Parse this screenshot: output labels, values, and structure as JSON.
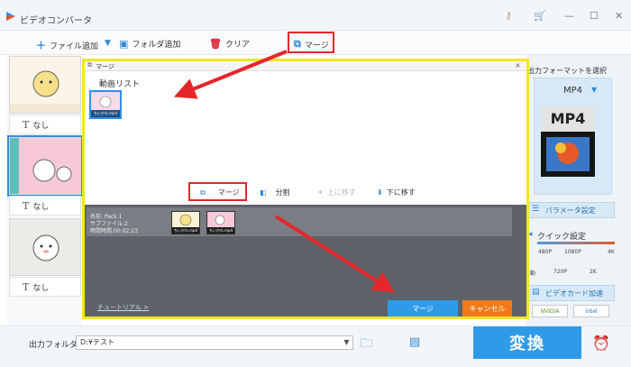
{
  "app": {
    "title": "ビデオコンバータ"
  },
  "window_controls": {
    "minimize": "—",
    "maximize": "☐",
    "close": "✕"
  },
  "toolbar": {
    "add_file": "ファイル追加",
    "add_folder": "フォルダ追加",
    "clear": "クリア",
    "merge": "マージ"
  },
  "file_list": {
    "items": [
      {
        "subtitle": "なし",
        "subtitle_icon": "T"
      },
      {
        "subtitle": "なし",
        "subtitle_icon": "T"
      },
      {
        "subtitle": "なし",
        "subtitle_icon": "T"
      }
    ]
  },
  "output_format": {
    "header": "出力フォーマットを選択",
    "name": "MP4",
    "icon_text": "MP4",
    "param_button": "パラメータ設定",
    "quick_label": "クイック設定",
    "quick_ticks_top": [
      "480P",
      "1080P",
      "4K"
    ],
    "quick_ticks_bottom": [
      "動",
      "720P",
      "2K"
    ],
    "gpu_button": "ビデオカード加速",
    "gpu_badges": [
      "NVIDIA",
      "intel"
    ]
  },
  "dialog": {
    "title": "マージ",
    "video_list_label": "動画リスト",
    "thumb_caption": "ちいかわ.mp4",
    "actions": {
      "merge": "マージ",
      "split": "分割",
      "move_up": "上に移す",
      "move_down": "下に移す"
    },
    "pack": {
      "name": "名前: Pack 1",
      "sub_files": "サブファイル:2",
      "duration": "時間時間:00:02:23",
      "thumb_captions": [
        "ちいかわ.mp4",
        "ちいかわ.mp4"
      ]
    },
    "tutorial_link": "チュートリアル >",
    "merge_button": "マージ",
    "cancel_button": "キャンセル"
  },
  "bottom": {
    "output_folder_label": "出力フォルダ：",
    "output_path": "D:¥テスト",
    "convert_button": "変換"
  },
  "colors": {
    "accent": "#2f9be8",
    "highlight": "#e6262a",
    "dialog_border": "#f2e622",
    "cancel": "#f07a1a"
  }
}
